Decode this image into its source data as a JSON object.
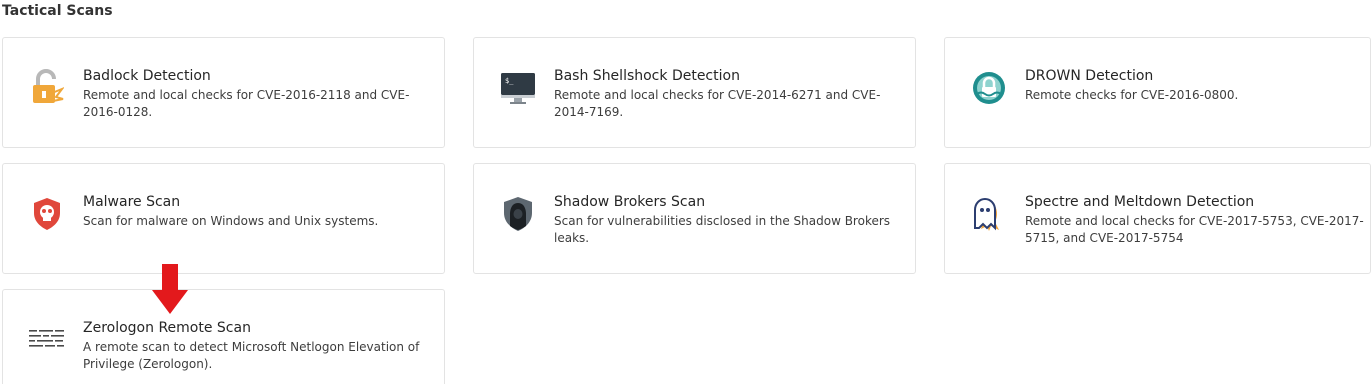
{
  "section": {
    "title": "Tactical Scans"
  },
  "scans": [
    {
      "name": "Badlock Detection",
      "description": "Remote and local checks for CVE-2016-2118 and CVE-2016-0128.",
      "icon": "unlocked-padlock-icon"
    },
    {
      "name": "Bash Shellshock Detection",
      "description": "Remote and local checks for CVE-2014-6271 and CVE-2014-7169.",
      "icon": "terminal-monitor-icon"
    },
    {
      "name": "DROWN Detection",
      "description": "Remote checks for CVE-2016-0800.",
      "icon": "drowning-lock-icon"
    },
    {
      "name": "Malware Scan",
      "description": "Scan for malware on Windows and Unix systems.",
      "icon": "skull-shield-icon"
    },
    {
      "name": "Shadow Brokers Scan",
      "description": "Scan for vulnerabilities disclosed in the Shadow Brokers leaks.",
      "icon": "hooded-figure-shield-icon"
    },
    {
      "name": "Spectre and Meltdown Detection",
      "description": "Remote and local checks for CVE-2017-5753, CVE-2017-5715, and CVE-2017-5754",
      "icon": "ghost-icon"
    },
    {
      "name": "Zerologon Remote Scan",
      "description": "A remote scan to detect Microsoft Netlogon Elevation of Privilege (Zerologon).",
      "icon": "code-text-icon"
    }
  ],
  "colors": {
    "arrow": "#e3191c",
    "badlock_orange": "#f0a73a",
    "drown_teal": "#1f8e8e",
    "malware_red": "#e0473b"
  }
}
